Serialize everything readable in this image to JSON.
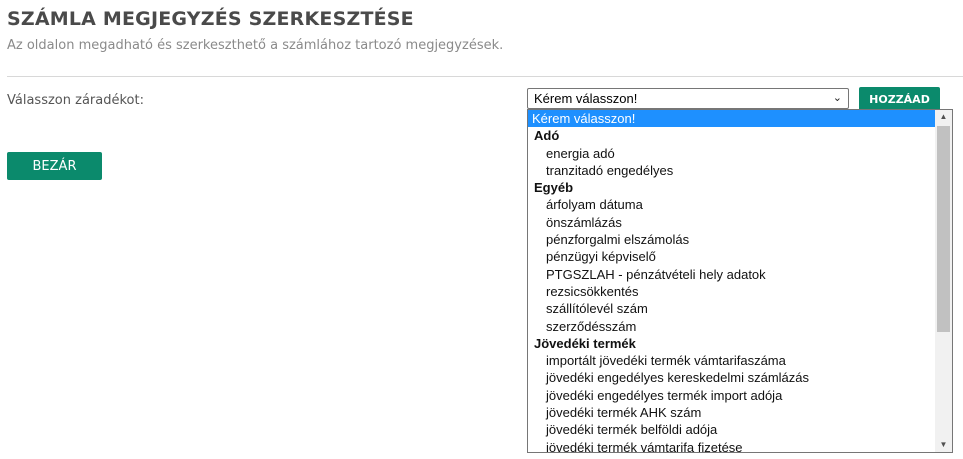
{
  "header": {
    "title": "SZÁMLA MEGJEGYZÉS SZERKESZTÉSE",
    "subtitle": "Az oldalon megadható és szerkeszthető a számlához tartozó megjegyzések."
  },
  "form": {
    "label": "Válasszon záradékot:",
    "select_value": "Kérem válasszon!",
    "add_label": "HOZZÁAD",
    "close_label": "BEZÁR"
  },
  "dropdown": {
    "options": [
      {
        "text": "Kérem válasszon!",
        "kind": "selected"
      },
      {
        "text": "Adó",
        "kind": "group"
      },
      {
        "text": "energia adó",
        "kind": "option"
      },
      {
        "text": "tranzitadó engedélyes",
        "kind": "option"
      },
      {
        "text": "Egyéb",
        "kind": "group"
      },
      {
        "text": "árfolyam dátuma",
        "kind": "option"
      },
      {
        "text": "önszámlázás",
        "kind": "option"
      },
      {
        "text": "pénzforgalmi elszámolás",
        "kind": "option"
      },
      {
        "text": "pénzügyi képviselő",
        "kind": "option"
      },
      {
        "text": "PTGSZLAH - pénzátvételi hely adatok",
        "kind": "option"
      },
      {
        "text": "rezsicsökkentés",
        "kind": "option"
      },
      {
        "text": "szállítólevél szám",
        "kind": "option"
      },
      {
        "text": "szerződésszám",
        "kind": "option"
      },
      {
        "text": "Jövedéki termék",
        "kind": "group"
      },
      {
        "text": "importált jövedéki termék vámtarifaszáma",
        "kind": "option"
      },
      {
        "text": "jövedéki engedélyes kereskedelmi számlázás",
        "kind": "option"
      },
      {
        "text": "jövedéki engedélyes termék import adója",
        "kind": "option"
      },
      {
        "text": "jövedéki termék AHK szám",
        "kind": "option"
      },
      {
        "text": "jövedéki termék belföldi adója",
        "kind": "option"
      },
      {
        "text": "jövedéki termék vámtarifa fizetése",
        "kind": "option"
      }
    ]
  },
  "icons": {
    "select_chevron": "chevron-down-icon",
    "scroll_up": "scroll-up-arrow-icon",
    "scroll_down": "scroll-down-arrow-icon"
  },
  "colors": {
    "accent": "#0b8a6c",
    "selected_option": "#1e90ff",
    "title": "#4a4a4a"
  }
}
